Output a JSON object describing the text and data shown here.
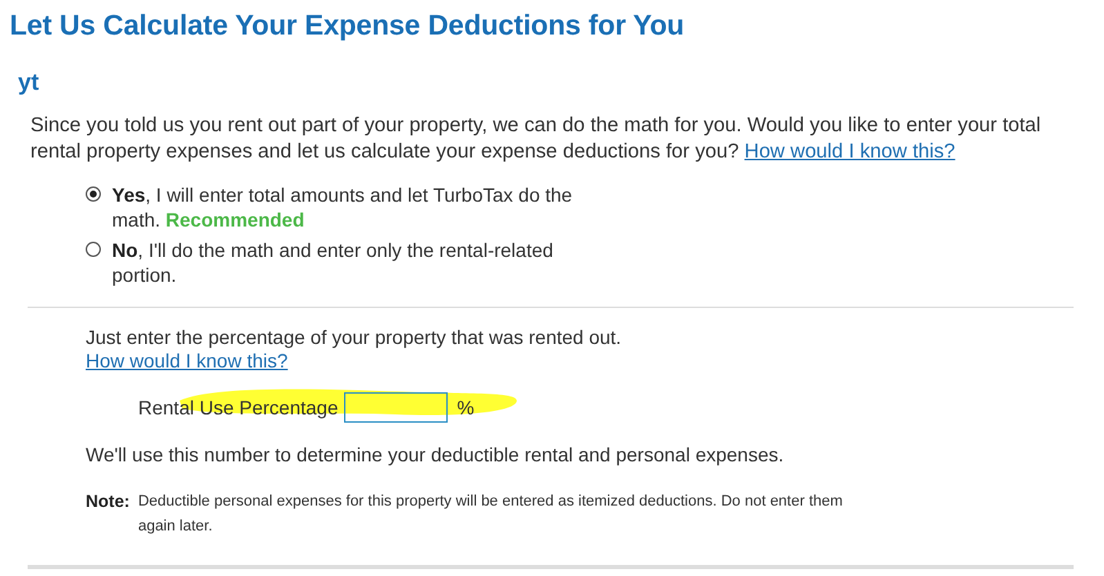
{
  "page": {
    "title": "Let Us Calculate Your Expense Deductions for You",
    "subtitle": "yt"
  },
  "intro": {
    "text": "Since you told us you rent out part of your property, we can do the math for you. Would you like to enter your total rental property expenses and let us calculate your expense deductions for you?",
    "link": "How would I know this?"
  },
  "options": [
    {
      "label": "**Yes**, I will enter total amounts and let TurboTax do the math.",
      "badge": "Recommended",
      "selected": true
    },
    {
      "label": "**No**, I'll do the math and enter only the rental-related portion.",
      "selected": false
    }
  ],
  "percentage": {
    "text": "Just enter the percentage of your property that was rented out.",
    "link": "How would I know this?",
    "field_label": "Rental Use Percentage",
    "unit": "%"
  },
  "explanation": "We'll use this number to determine your deductible rental and personal expenses.",
  "note": {
    "label": "Note:",
    "text": "Deductible personal expenses for this property will be entered as itemized deductions. Do not enter them again later."
  }
}
